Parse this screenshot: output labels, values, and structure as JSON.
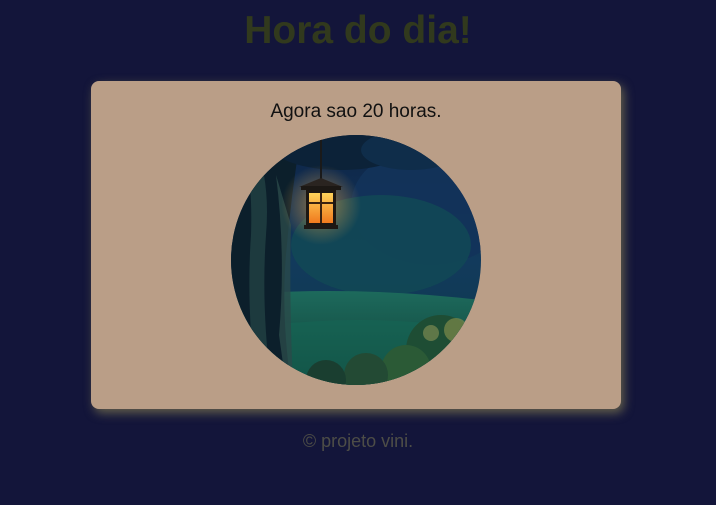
{
  "header": {
    "title": "Hora do dia!"
  },
  "card": {
    "message": "Agora sao 20 horas.",
    "image_subject": "night-lantern-garden"
  },
  "footer": {
    "text": "© projeto vini."
  },
  "colors": {
    "background": "#13153a",
    "title": "#31391d",
    "card": "#ba9e87",
    "footer_text": "#4d4d47"
  }
}
